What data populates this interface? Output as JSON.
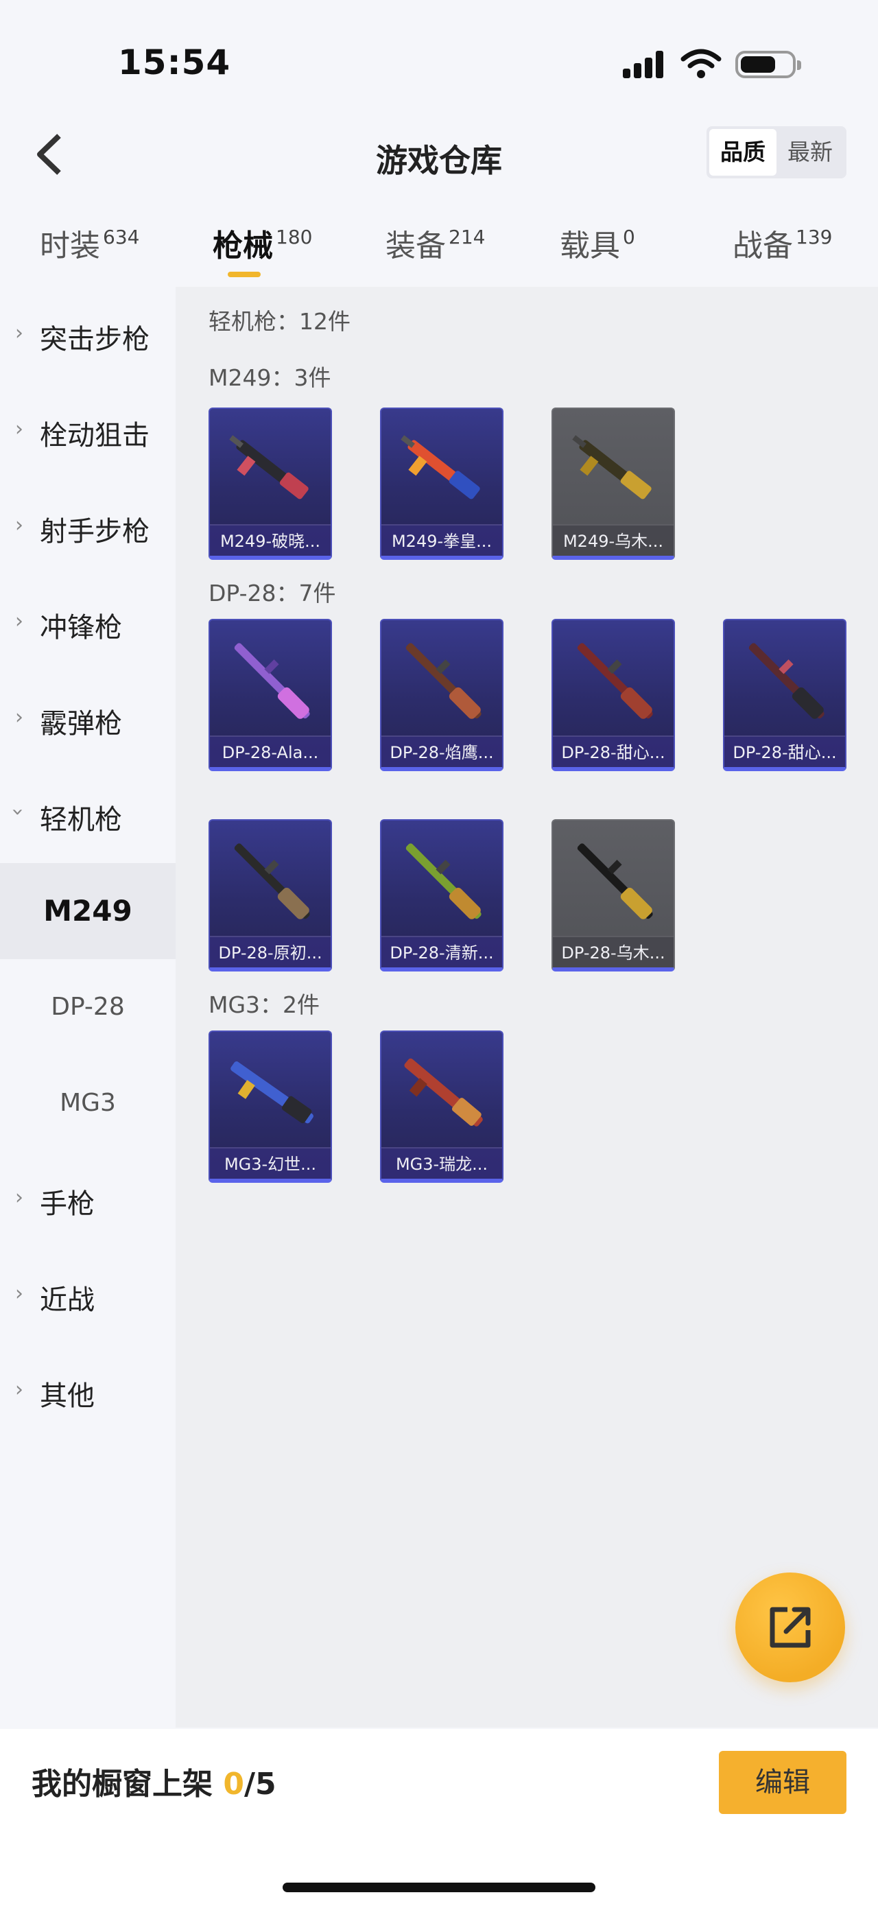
{
  "status_bar": {
    "time": "15:54"
  },
  "header": {
    "title": "游戏仓库",
    "sort": [
      "品质",
      "最新"
    ]
  },
  "tabs": [
    {
      "label": "时装",
      "count": "634"
    },
    {
      "label": "枪械",
      "count": "180"
    },
    {
      "label": "装备",
      "count": "214"
    },
    {
      "label": "载具",
      "count": "0"
    },
    {
      "label": "战备",
      "count": "139"
    }
  ],
  "sidebar": {
    "categories": [
      "突击步枪",
      "栓动狙击",
      "射手步枪",
      "冲锋枪",
      "霰弹枪",
      "轻机枪",
      "手枪",
      "近战",
      "其他"
    ],
    "subitems": [
      "M249",
      "DP-28",
      "MG3"
    ]
  },
  "main": {
    "summary": "轻机枪：12件",
    "groups": [
      {
        "title": "M249：3件",
        "items": [
          "M249-破晓...",
          "M249-拳皇...",
          "M249-乌木..."
        ]
      },
      {
        "title": "DP-28：7件",
        "items": [
          "DP-28-Ala...",
          "DP-28-焰鹰...",
          "DP-28-甜心...",
          "DP-28-甜心...",
          "DP-28-原初...",
          "DP-28-清新...",
          "DP-28-乌木..."
        ]
      },
      {
        "title": "MG3：2件",
        "items": [
          "MG3-幻世...",
          "MG3-瑞龙..."
        ]
      }
    ]
  },
  "bottom": {
    "label": "我的橱窗上架",
    "count": "0",
    "total": "/5",
    "edit_label": "编辑"
  },
  "colors": {
    "accent": "#f1b62c",
    "card_purple": "#2f2f70",
    "card_gray": "#55565b"
  }
}
